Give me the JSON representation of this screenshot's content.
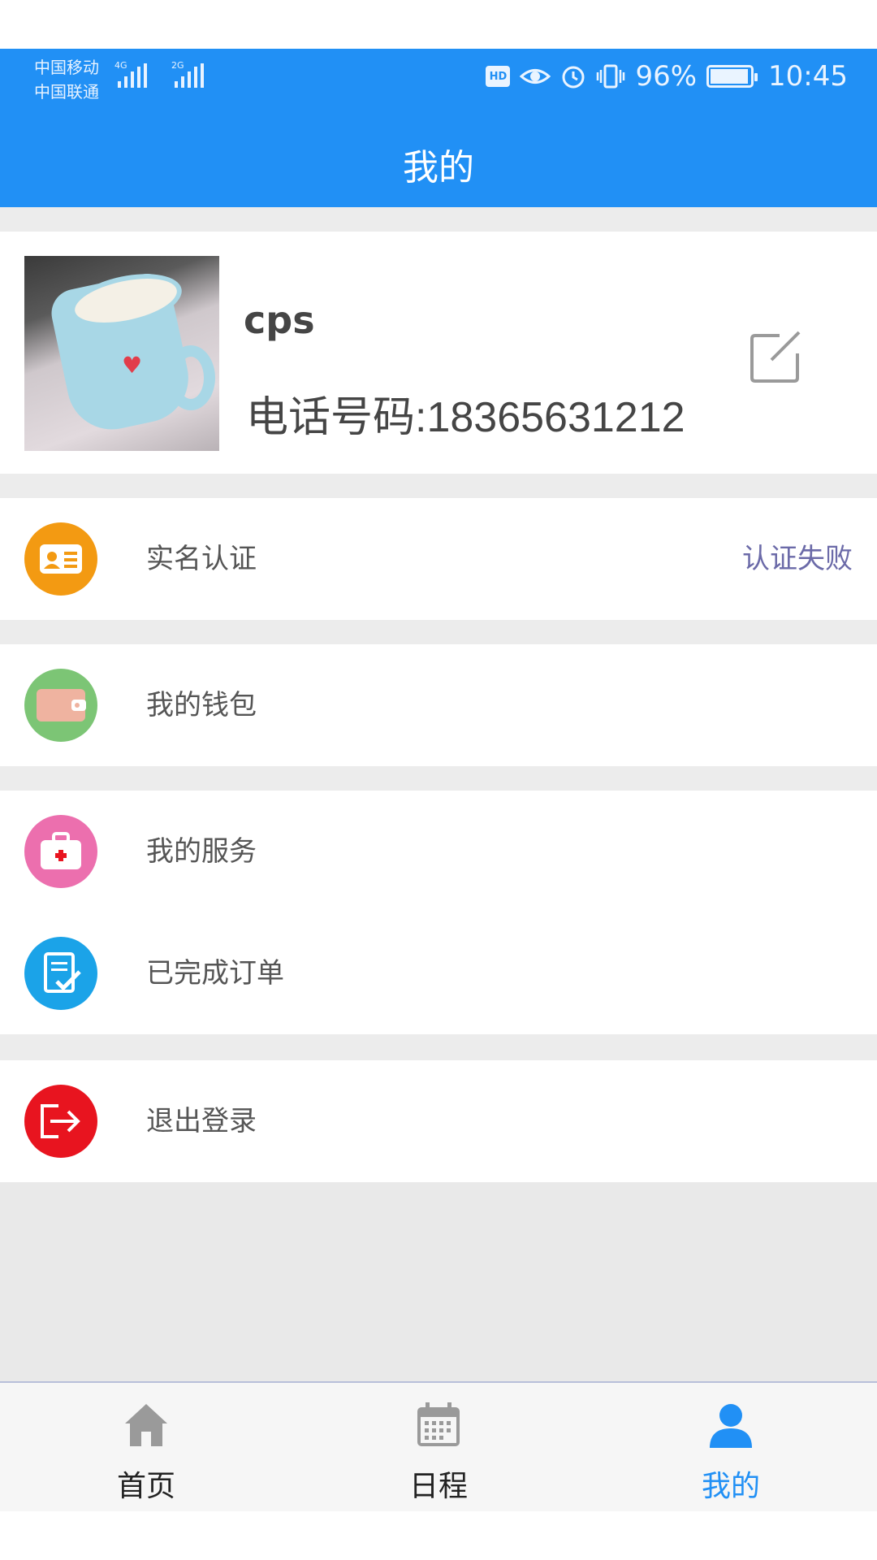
{
  "status_bar": {
    "carrier_1": "中国移动",
    "carrier_2": "中国联通",
    "network_1": "4G",
    "network_2": "2G",
    "battery_percent": "96%",
    "time": "10:45",
    "hd_label": "HD",
    "battery_level": 0.96
  },
  "header": {
    "title": "我的"
  },
  "profile": {
    "username": "cps",
    "phone": "电话号码:18365631212"
  },
  "menu": {
    "real_name": {
      "label": "实名认证",
      "status": "认证失败",
      "icon": "id-card-icon",
      "color": "#f39a12"
    },
    "wallet": {
      "label": "我的钱包",
      "icon": "wallet-icon",
      "color": "#7cc575"
    },
    "services": {
      "label": "我的服务",
      "icon": "medical-kit-icon",
      "color": "#ec6fae"
    },
    "completed_orders": {
      "label": "已完成订单",
      "icon": "order-check-icon",
      "color": "#1ba3e8"
    },
    "logout": {
      "label": "退出登录",
      "icon": "logout-icon",
      "color": "#e8141f"
    }
  },
  "tabbar": {
    "home": "首页",
    "schedule": "日程",
    "mine": "我的",
    "active_color": "#2190f5"
  }
}
